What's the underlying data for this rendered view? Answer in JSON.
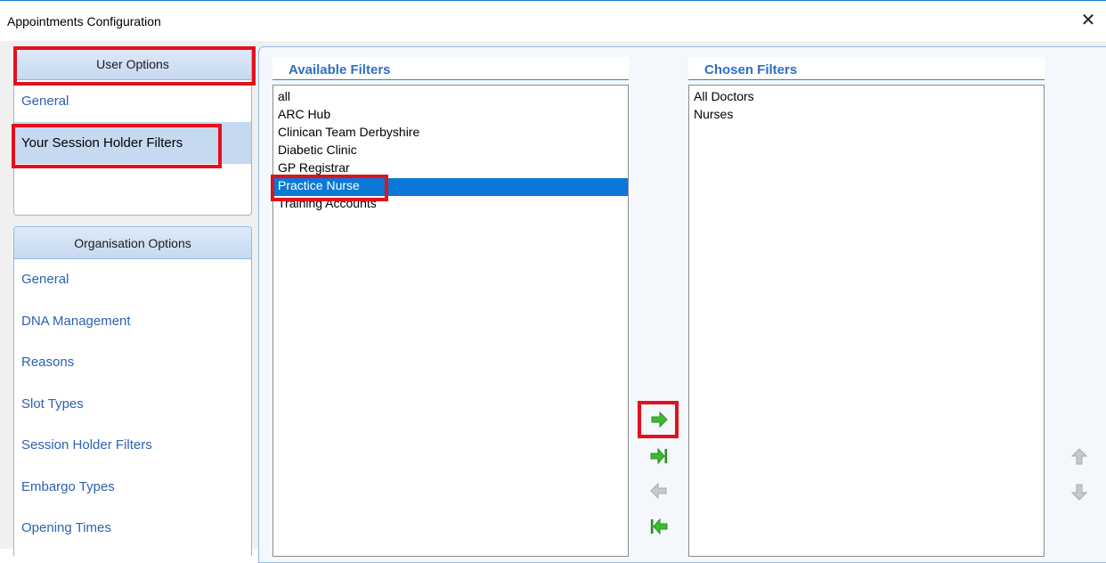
{
  "window": {
    "title": "Appointments Configuration",
    "close_glyph": "✕"
  },
  "user_options": {
    "header": "User Options",
    "items": [
      {
        "label": "General",
        "selected": false
      },
      {
        "label": "Your Session Holder Filters",
        "selected": true
      }
    ]
  },
  "org_options": {
    "header": "Organisation Options",
    "items": [
      {
        "label": "General"
      },
      {
        "label": "DNA Management"
      },
      {
        "label": "Reasons"
      },
      {
        "label": "Slot Types"
      },
      {
        "label": "Session Holder Filters"
      },
      {
        "label": "Embargo Types"
      },
      {
        "label": "Opening Times"
      }
    ]
  },
  "available": {
    "header": "Available Filters",
    "items": [
      {
        "label": "all"
      },
      {
        "label": "ARC Hub"
      },
      {
        "label": "Clinican Team Derbyshire"
      },
      {
        "label": "Diabetic Clinic"
      },
      {
        "label": "GP Registrar"
      },
      {
        "label": "Practice Nurse",
        "selected": true
      },
      {
        "label": "Training Accounts"
      }
    ]
  },
  "chosen": {
    "header": "Chosen Filters",
    "items": [
      {
        "label": "All Doctors"
      },
      {
        "label": "Nurses"
      }
    ]
  },
  "buttons": {
    "add": "add-selected-arrow-icon",
    "add_all": "add-all-arrow-icon",
    "remove": "remove-selected-arrow-icon",
    "remove_all": "remove-all-arrow-icon",
    "move_up": "move-up-arrow-icon",
    "move_down": "move-down-arrow-icon"
  },
  "colors": {
    "accent_green": "#3dbb2b",
    "highlight_red": "#e3101d",
    "selection_blue": "#0a78d7",
    "disabled_gray": "#b5b5b5"
  }
}
